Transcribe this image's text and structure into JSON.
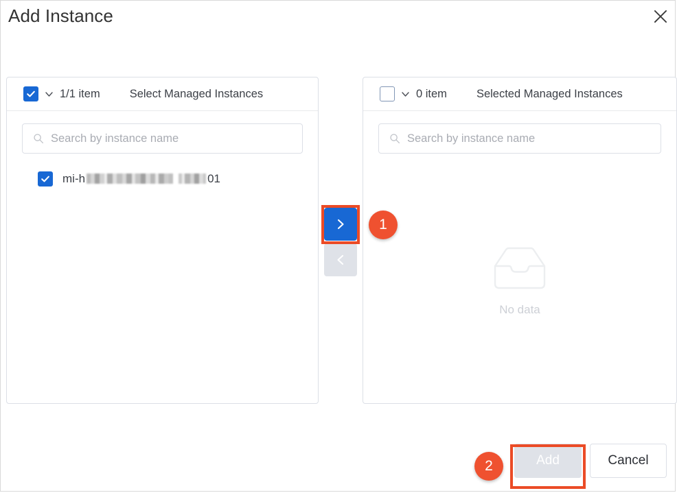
{
  "dialog": {
    "title": "Add Instance",
    "close_icon": "close-icon"
  },
  "panels": {
    "left": {
      "checkbox_state": "checked",
      "count_label": "1/1 item",
      "caption": "Select Managed Instances",
      "search_placeholder": "Search by instance name",
      "search_value": "",
      "items": [
        {
          "prefix": "mi-h",
          "redacted": true,
          "suffix": "01",
          "checked": true
        }
      ]
    },
    "right": {
      "checkbox_state": "unchecked",
      "count_label": "0 item",
      "caption": "Selected Managed Instances",
      "search_placeholder": "Search by instance name",
      "search_value": "",
      "empty_text": "No data",
      "empty_icon": "inbox-icon"
    }
  },
  "transfer": {
    "to_right_icon": "chevron-right-icon",
    "to_right_enabled": true,
    "to_left_icon": "chevron-left-icon",
    "to_left_enabled": false
  },
  "footer": {
    "add_label": "Add",
    "add_enabled": false,
    "cancel_label": "Cancel",
    "cancel_enabled": true
  },
  "annotations": {
    "badge_1": "1",
    "badge_2": "2",
    "highlight_color": "#eb4b26",
    "badge_color": "#ef5130"
  },
  "colors": {
    "primary": "#1868d4",
    "disabled": "#dfe2e8",
    "border": "#dcdfe6",
    "text": "#3b3f46",
    "placeholder": "#a9acb3"
  }
}
